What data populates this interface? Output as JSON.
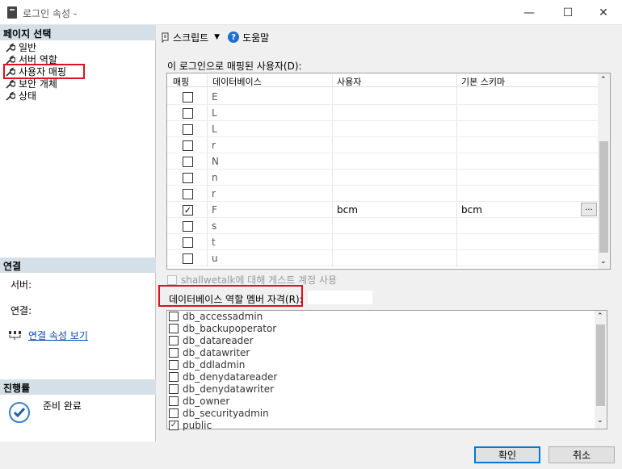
{
  "window": {
    "title": "로그인 속성 -",
    "minimize": "—",
    "maximize": "☐",
    "close": "✕"
  },
  "left": {
    "page_select_header": "페이지 선택",
    "pages": [
      {
        "label": "일반"
      },
      {
        "label": "서버 역할"
      },
      {
        "label": "사용자 매핑"
      },
      {
        "label": "보안 개체"
      },
      {
        "label": "상태"
      }
    ],
    "connection_header": "연결",
    "server_label": "서버:",
    "connection_label": "연결:",
    "view_connection_props": "연결 속성 보기",
    "progress_header": "진행률",
    "progress_status": "준비 완료"
  },
  "toolbar": {
    "script_label": "스크립트",
    "help_label": "도움말"
  },
  "mapping": {
    "label": "이 로그인으로 매핑된 사용자(D):",
    "columns": [
      "매핑",
      "데이터베이스",
      "사용자",
      "기본 스키마"
    ],
    "rows": [
      {
        "checked": false,
        "db": "E",
        "user": "",
        "schema": ""
      },
      {
        "checked": false,
        "db": "L",
        "user": "",
        "schema": ""
      },
      {
        "checked": false,
        "db": "L",
        "user": "",
        "schema": ""
      },
      {
        "checked": false,
        "db": "r",
        "user": "",
        "schema": ""
      },
      {
        "checked": false,
        "db": "N",
        "user": "",
        "schema": ""
      },
      {
        "checked": false,
        "db": "n",
        "user": "",
        "schema": ""
      },
      {
        "checked": false,
        "db": "r",
        "user": "",
        "schema": ""
      },
      {
        "checked": true,
        "db": "F",
        "user": "bcm",
        "schema": "bcm",
        "ellipsis": "..."
      },
      {
        "checked": false,
        "db": "s",
        "user": "",
        "schema": ""
      },
      {
        "checked": false,
        "db": "t",
        "user": "",
        "schema": ""
      },
      {
        "checked": false,
        "db": "u",
        "user": "",
        "schema": ""
      }
    ]
  },
  "guest": {
    "label": "shallwetalk에 대해 게스트 계정 사용"
  },
  "roles": {
    "label": "데이터베이스 역할 멤버 자격(R):",
    "items": [
      {
        "name": "db_accessadmin",
        "checked": false
      },
      {
        "name": "db_backupoperator",
        "checked": false
      },
      {
        "name": "db_datareader",
        "checked": false
      },
      {
        "name": "db_datawriter",
        "checked": false
      },
      {
        "name": "db_ddladmin",
        "checked": false
      },
      {
        "name": "db_denydatareader",
        "checked": false
      },
      {
        "name": "db_denydatawriter",
        "checked": false
      },
      {
        "name": "db_owner",
        "checked": false
      },
      {
        "name": "db_securityadmin",
        "checked": false
      },
      {
        "name": "public",
        "checked": true
      }
    ]
  },
  "buttons": {
    "ok": "확인",
    "cancel": "취소"
  },
  "colors": {
    "highlight": "#e0101c",
    "section_header": "#d5dfe8",
    "link": "#0645ad"
  }
}
